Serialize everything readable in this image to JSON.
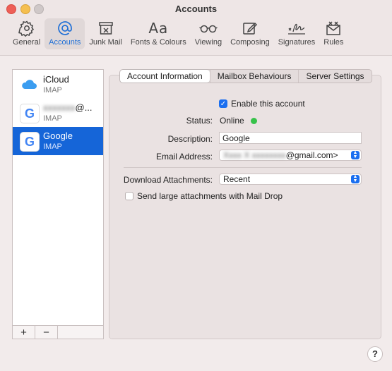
{
  "window": {
    "title": "Accounts"
  },
  "toolbar": {
    "items": [
      {
        "label": "General",
        "icon": "gear-icon",
        "active": false
      },
      {
        "label": "Accounts",
        "icon": "at-sign-icon",
        "active": true
      },
      {
        "label": "Junk Mail",
        "icon": "junk-tray-icon",
        "active": false
      },
      {
        "label": "Fonts & Colours",
        "icon": "font-aa-icon",
        "active": false
      },
      {
        "label": "Viewing",
        "icon": "glasses-icon",
        "active": false
      },
      {
        "label": "Composing",
        "icon": "compose-icon",
        "active": false
      },
      {
        "label": "Signatures",
        "icon": "signature-icon",
        "active": false
      },
      {
        "label": "Rules",
        "icon": "rules-envelope-icon",
        "active": false
      }
    ]
  },
  "accounts": [
    {
      "name": "iCloud",
      "type": "IMAP",
      "icon": "icloud-icon",
      "selected": false
    },
    {
      "name": "@...",
      "type": "IMAP",
      "icon": "google-icon",
      "selected": false
    },
    {
      "name": "Google",
      "type": "IMAP",
      "icon": "google-icon",
      "selected": true
    }
  ],
  "list_footer": {
    "add": "+",
    "remove": "−"
  },
  "tabs": [
    {
      "label": "Account Information",
      "active": true
    },
    {
      "label": "Mailbox Behaviours",
      "active": false
    },
    {
      "label": "Server Settings",
      "active": false
    }
  ],
  "form": {
    "enable_label": "Enable this account",
    "enable_checked": true,
    "status_label": "Status:",
    "status_value": "Online",
    "status_color": "#37c24a",
    "description_label": "Description:",
    "description_value": "Google",
    "email_label": "Email Address:",
    "email_value": "@gmail.com>",
    "download_label": "Download Attachments:",
    "download_value": "Recent",
    "mail_drop_label": "Send large attachments with Mail Drop",
    "mail_drop_checked": false
  },
  "help": {
    "label": "?"
  },
  "colors": {
    "accent": "#1565d8",
    "close": "#ee5f57",
    "minimize": "#f5bf4f",
    "zoom": "#cfc8c8"
  }
}
